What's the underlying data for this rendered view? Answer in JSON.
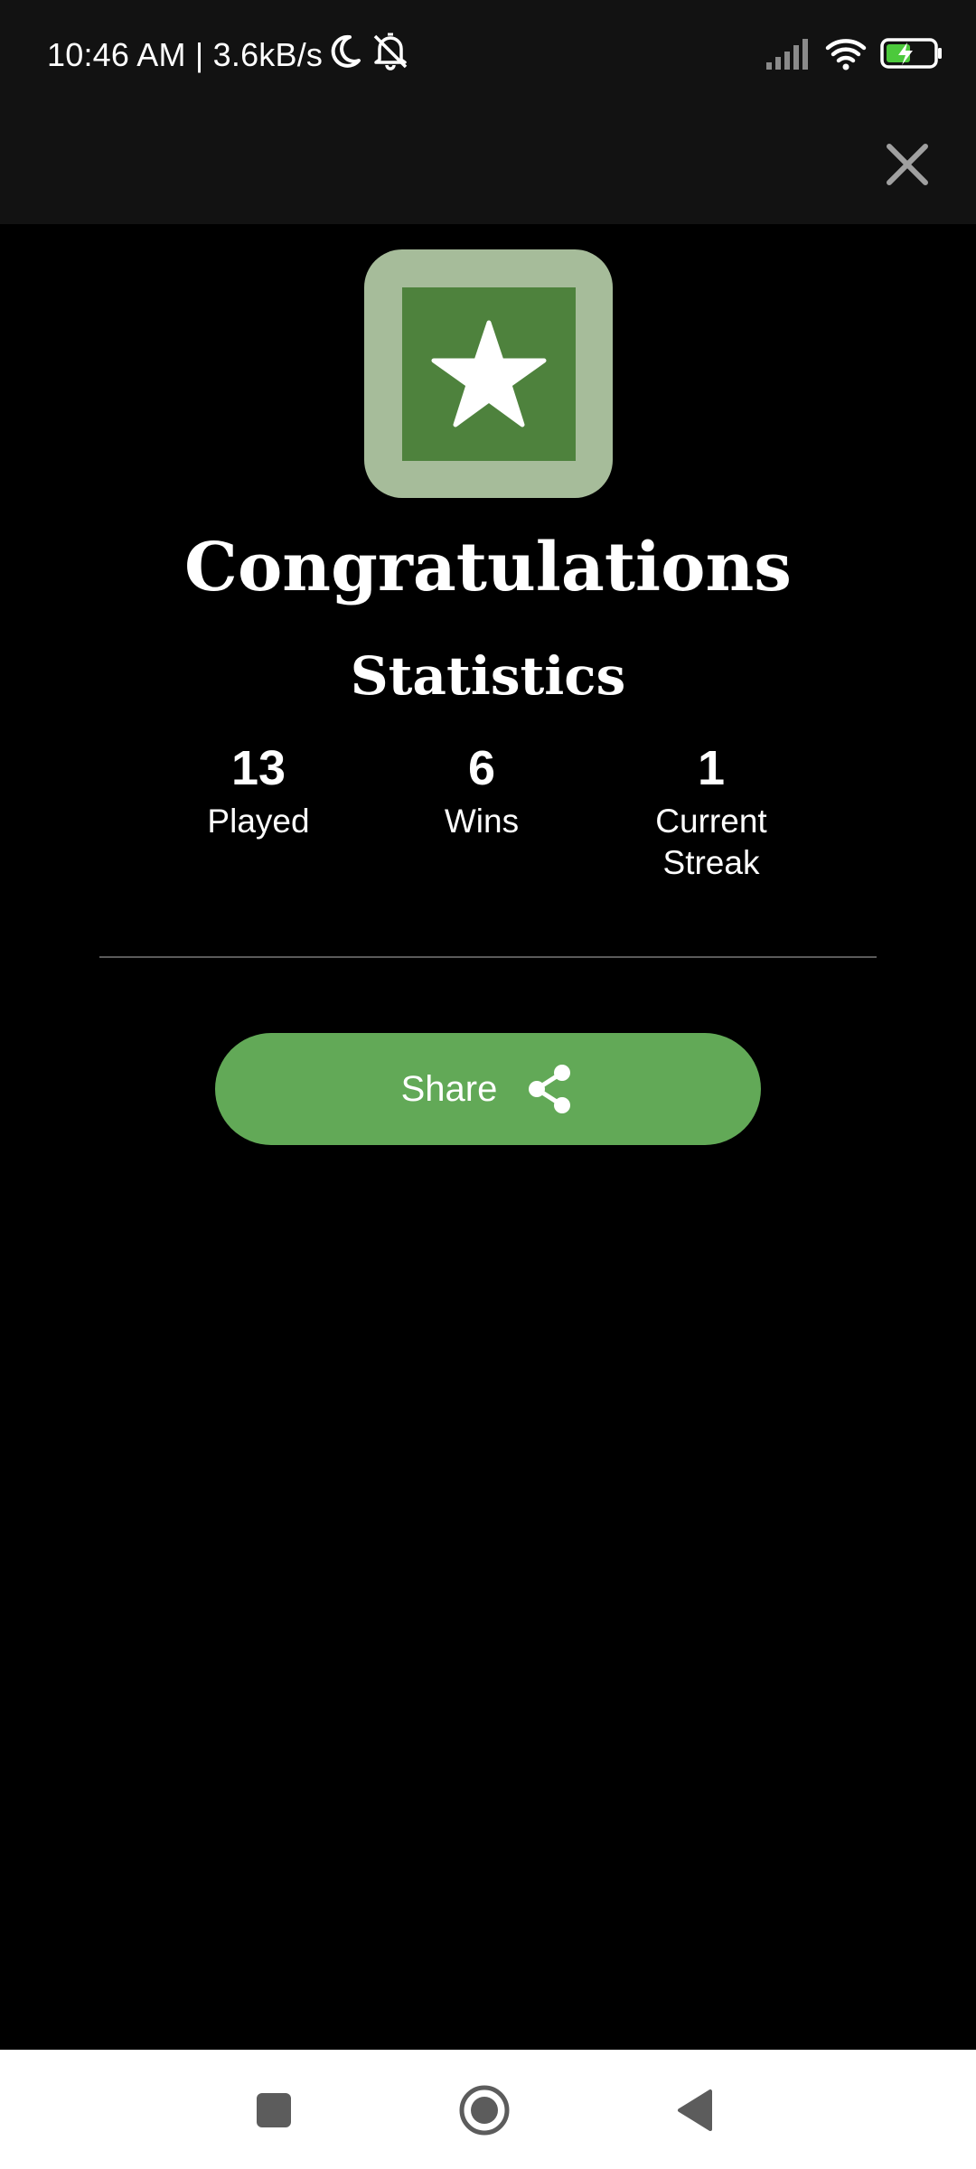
{
  "status_bar": {
    "time_speed": "10:46 AM | 3.6kB/s",
    "icons": [
      "moon-icon",
      "silent-bell-icon",
      "signal-icon",
      "wifi-icon",
      "battery-charging-icon"
    ]
  },
  "app_bar": {
    "close_icon": "close-icon"
  },
  "badge": {
    "icon": "star-icon"
  },
  "header": {
    "title": "Congratulations",
    "subtitle": "Statistics"
  },
  "stats": [
    {
      "value": "13",
      "label": "Played"
    },
    {
      "value": "6",
      "label": "Wins"
    },
    {
      "value": "1",
      "label": "Current Streak"
    }
  ],
  "share": {
    "label": "Share",
    "icon": "share-icon"
  },
  "nav_bar": {
    "icons": [
      "recents-square-icon",
      "home-circle-icon",
      "back-triangle-icon"
    ]
  },
  "colors": {
    "status_bar_bg": "#121212",
    "background": "#000000",
    "badge_outer": "#a6bc9a",
    "badge_inner": "#4e823d",
    "share_button": "#62a957",
    "nav_bar_bg": "#ffffff",
    "nav_icons": "#5c5c5c",
    "close_icon": "#a0a0a0"
  }
}
